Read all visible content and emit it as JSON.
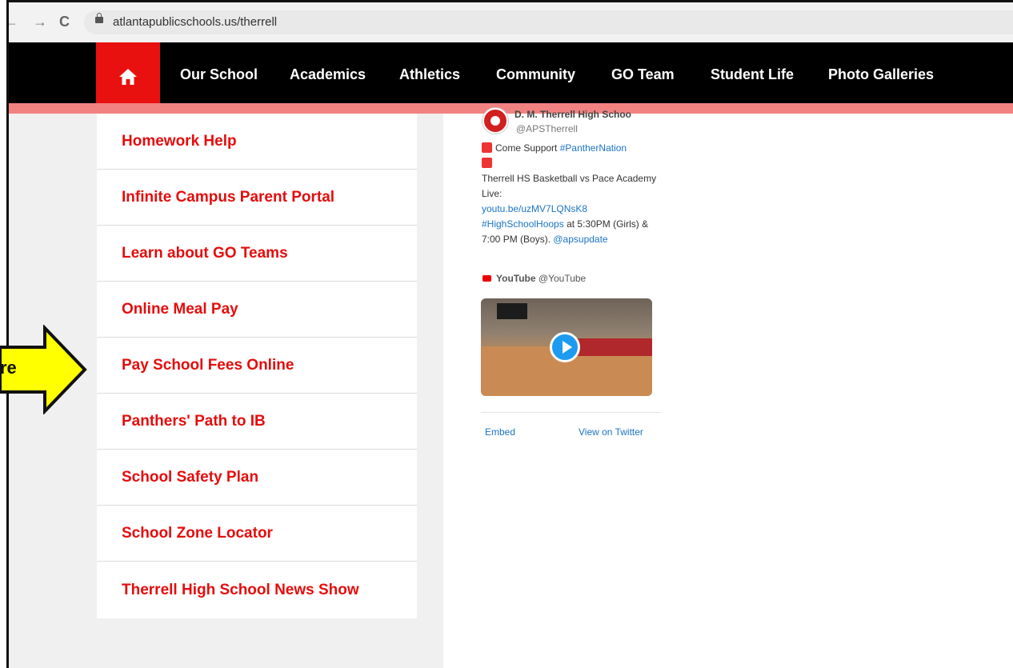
{
  "browser": {
    "back": "←",
    "forward": "→",
    "reload": "C",
    "url": "atlantapublicschools.us/therrell"
  },
  "nav": {
    "home_icon": "home-icon",
    "items": [
      "Our School",
      "Academics",
      "Athletics",
      "Community",
      "GO Team",
      "Student Life",
      "Photo Galleries"
    ]
  },
  "menu": [
    "Homework Help",
    "Infinite Campus Parent Portal",
    "Learn about GO Teams",
    "Online Meal Pay",
    "Pay School Fees Online",
    "Panthers' Path to IB",
    "School Safety Plan",
    "School Zone Locator",
    "Therrell High School News Show"
  ],
  "tweet": {
    "name": "D. M. Therrell High Schoo",
    "handle": "@APSTherrell",
    "line1_prefix": "Come Support ",
    "line1_link": "#PantherNation",
    "line2": "Therrell HS Basketball vs Pace Academy Live:",
    "link_url": "youtu.be/uzMV7LQNsK8",
    "hashtag": "#HighSchoolHoops",
    "line3_suffix": " at 5:30PM (Girls) & 7:00 PM (Boys). ",
    "mention": "@apsupdate",
    "yt_label": "YouTube",
    "yt_handle": "@YouTube",
    "embed": "Embed",
    "view": "View on Twitter"
  },
  "annotation": {
    "label": "re",
    "color": "#ffff00"
  },
  "colors": {
    "brand_red": "#e50d0c",
    "nav_bg": "#000000",
    "strip": "#f28281",
    "link_blue": "#1b74c5"
  }
}
